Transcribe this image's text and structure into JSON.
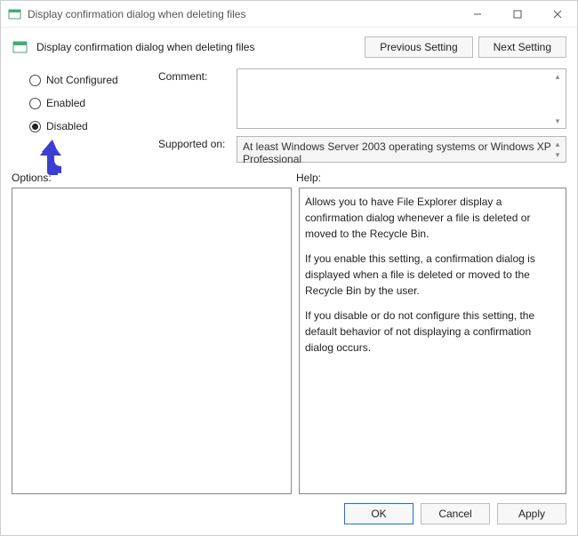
{
  "titlebar": {
    "title": "Display confirmation dialog when deleting files"
  },
  "header": {
    "title": "Display confirmation dialog when deleting files",
    "previous": "Previous Setting",
    "next": "Next Setting"
  },
  "radios": {
    "not_configured": "Not Configured",
    "enabled": "Enabled",
    "disabled": "Disabled",
    "selected": "disabled"
  },
  "fields": {
    "comment_label": "Comment:",
    "comment_value": "",
    "supported_label": "Supported on:",
    "supported_value": "At least Windows Server 2003 operating systems or Windows XP Professional"
  },
  "sections": {
    "options_label": "Options:",
    "help_label": "Help:"
  },
  "help": {
    "p1": "Allows you to have File Explorer display a confirmation dialog whenever a file is deleted or moved to the Recycle Bin.",
    "p2": "If you enable this setting, a confirmation dialog is displayed when a file is deleted or moved to the Recycle Bin by the user.",
    "p3": "If you disable or do not configure this setting, the default behavior of not displaying a confirmation dialog occurs."
  },
  "buttons": {
    "ok": "OK",
    "cancel": "Cancel",
    "apply": "Apply"
  },
  "annotation": {
    "arrow_color": "#3b3fd1"
  }
}
